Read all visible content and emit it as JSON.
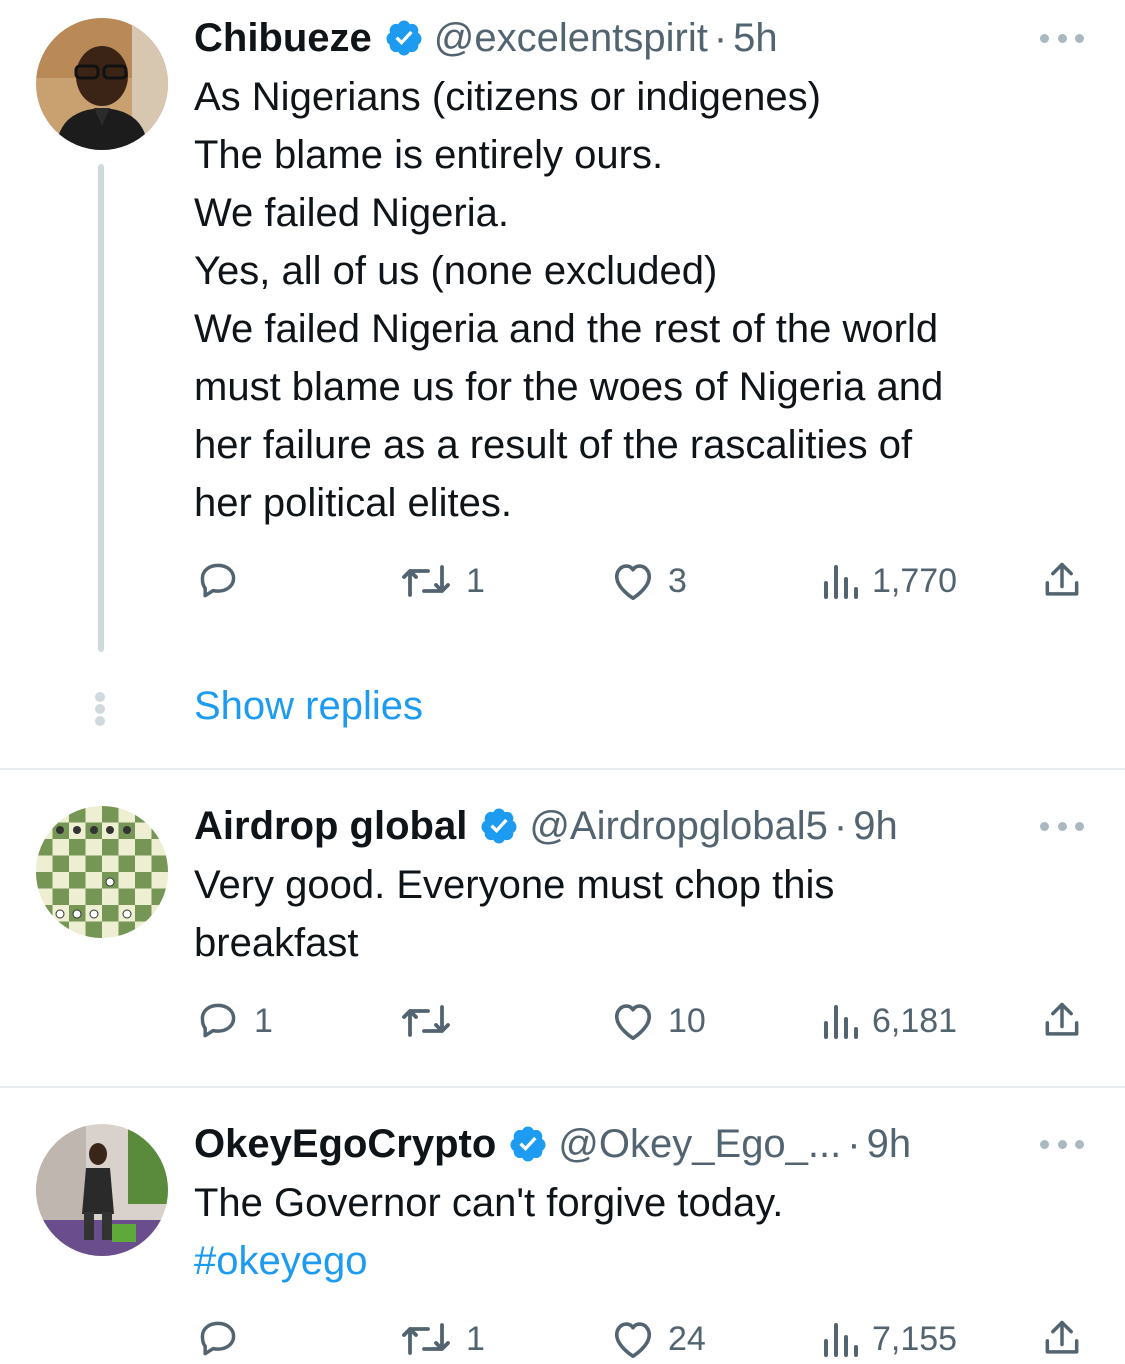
{
  "colors": {
    "accent": "#1d9bf0",
    "muted": "#536471",
    "verified": "#1d9bf0"
  },
  "tweets": [
    {
      "name": "Chibueze",
      "handle": "@excelentspirit",
      "dot": "·",
      "time": "5h",
      "lines": [
        "As Nigerians (citizens or indigenes)",
        "The blame is entirely ours.",
        "We failed Nigeria.",
        "Yes, all of us (none excluded)",
        "We failed Nigeria and the rest of the world",
        "must blame us for the woes of Nigeria and",
        "her failure as a result of the rascalities of",
        "her political elites."
      ],
      "replies": "",
      "retweets": "1",
      "likes": "3",
      "views": "1,770",
      "show_replies": "Show replies"
    },
    {
      "name": "Airdrop global",
      "handle": "@Airdropglobal5",
      "dot": "·",
      "time": "9h",
      "lines": [
        "Very good. Everyone must chop this",
        "breakfast"
      ],
      "replies": "1",
      "retweets": "",
      "likes": "10",
      "views": "6,181"
    },
    {
      "name": "OkeyEgoCrypto",
      "handle": "@Okey_Ego_...",
      "dot": "·",
      "time": "9h",
      "lines": [
        "The Governor can't forgive today."
      ],
      "hashtag": "#okeyego",
      "replies": "",
      "retweets": "1",
      "likes": "24",
      "views": "7,155"
    }
  ]
}
